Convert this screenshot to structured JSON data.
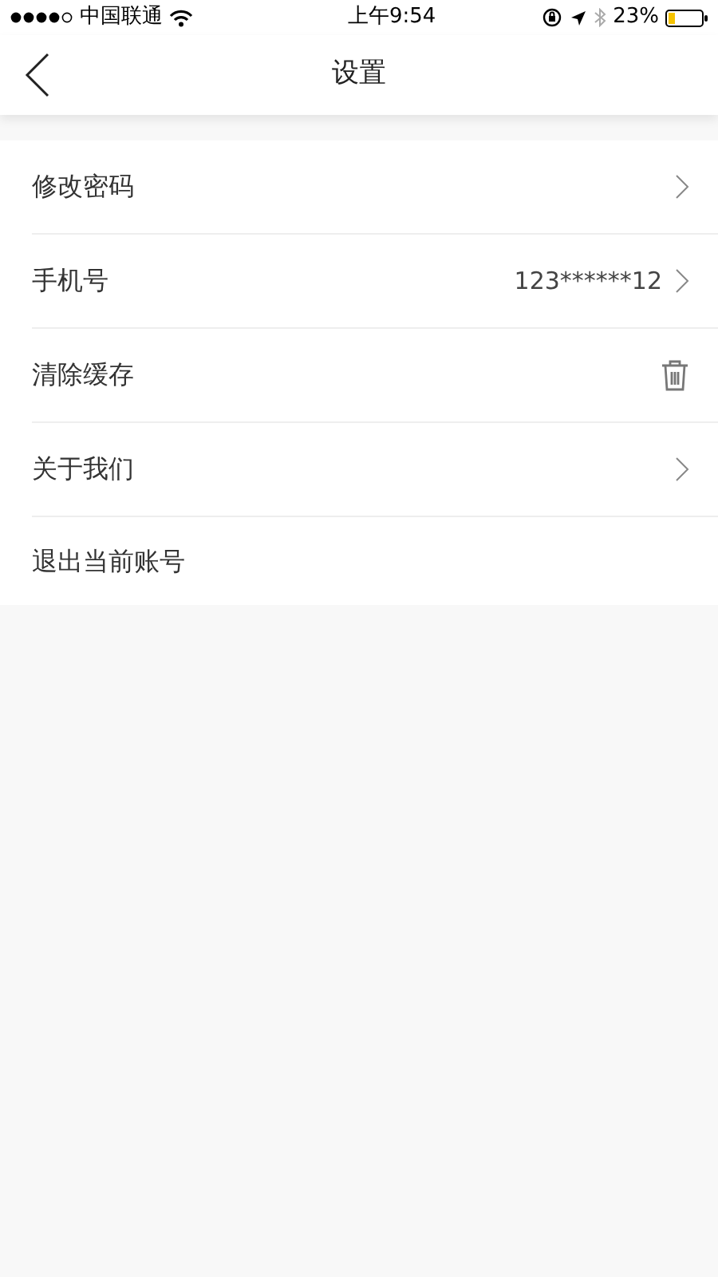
{
  "status_bar": {
    "carrier": "中国联通",
    "time": "上午9:54",
    "battery": "23%"
  },
  "nav_bar": {
    "title": "设置"
  },
  "items": [
    {
      "label": "修改密码",
      "kind": "chevron"
    },
    {
      "label": "手机号",
      "value": "123******12",
      "kind": "chevron"
    },
    {
      "label": "清除缓存",
      "kind": "trash"
    },
    {
      "label": "关于我们",
      "kind": "chevron"
    },
    {
      "label": "退出当前账号",
      "kind": "none"
    }
  ]
}
